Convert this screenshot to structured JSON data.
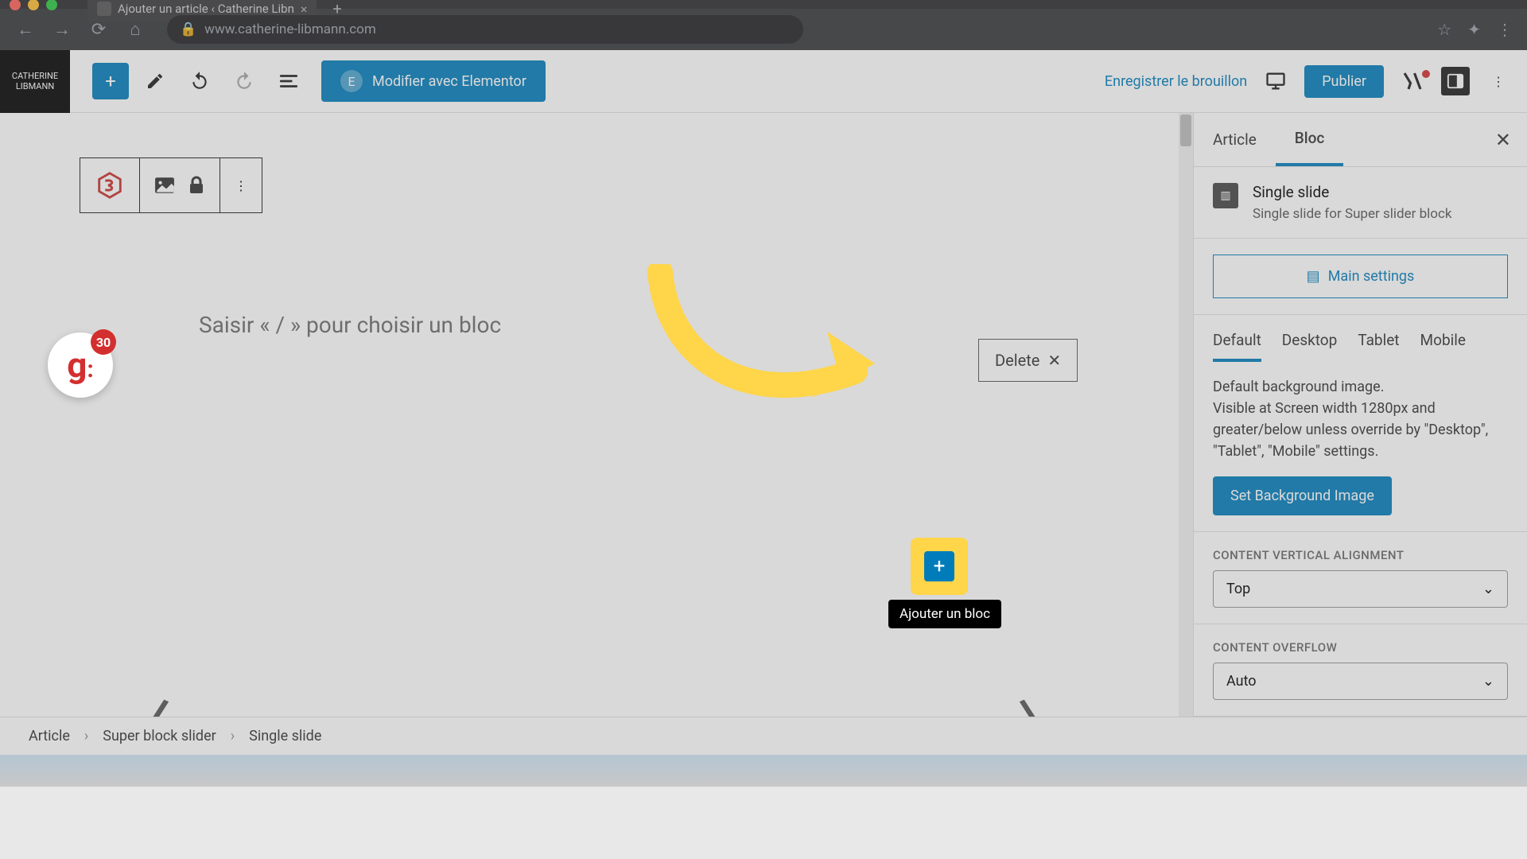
{
  "browser": {
    "tab_title": "Ajouter un article ‹ Catherine Libn",
    "url": "www.catherine-libmann.com"
  },
  "site_logo": {
    "line1": "CATHERINE",
    "line2": "LIBMANN"
  },
  "toolbar": {
    "elementor_label": "Modifier avec Elementor",
    "save_draft_label": "Enregistrer le brouillon",
    "publish_label": "Publier"
  },
  "canvas": {
    "placeholder": "Saisir « / » pour choisir un bloc",
    "delete_label": "Delete",
    "add_block_tooltip": "Ajouter un bloc"
  },
  "getgenie_count": "30",
  "sidebar": {
    "tab_article": "Article",
    "tab_bloc": "Bloc",
    "block_title": "Single slide",
    "block_desc": "Single slide for Super slider block",
    "main_settings_label": "Main settings",
    "device_tabs": {
      "default": "Default",
      "desktop": "Desktop",
      "tablet": "Tablet",
      "mobile": "Mobile"
    },
    "default_desc": "Default background image.\nVisible at Screen width 1280px and greater/below unless override by \"Desktop\", \"Tablet\", \"Mobile\" settings.",
    "set_bg_label": "Set Background Image",
    "vertical_align_label": "CONTENT VERTICAL ALIGNMENT",
    "vertical_align_value": "Top",
    "overflow_label": "CONTENT OVERFLOW",
    "overflow_value": "Auto"
  },
  "breadcrumb": {
    "level1": "Article",
    "level2": "Super block slider",
    "level3": "Single slide"
  }
}
